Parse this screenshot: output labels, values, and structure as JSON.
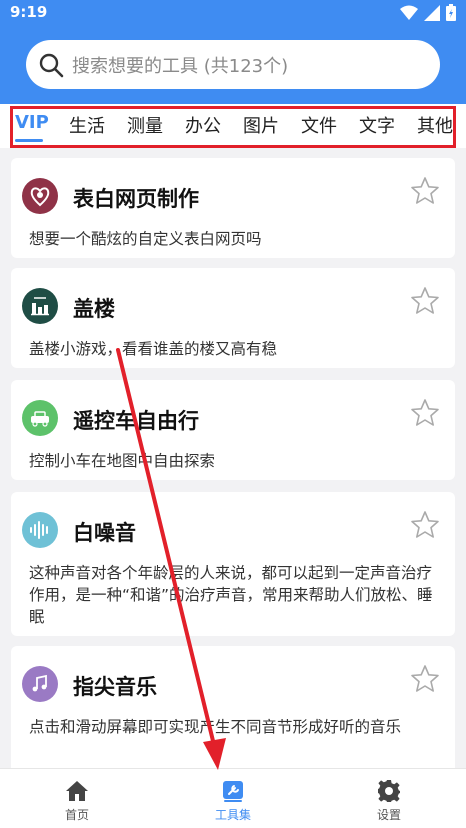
{
  "status_bar": {
    "time": "9:19"
  },
  "search": {
    "placeholder": "搜索想要的工具 (共123个)"
  },
  "tabs": [
    {
      "label": "VIP"
    },
    {
      "label": "生活"
    },
    {
      "label": "测量"
    },
    {
      "label": "办公"
    },
    {
      "label": "图片"
    },
    {
      "label": "文件"
    },
    {
      "label": "文字"
    },
    {
      "label": "其他"
    }
  ],
  "cards": [
    {
      "title": "表白网页制作",
      "desc": "想要一个酷炫的自定义表白网页吗",
      "icon": "heart-badge-icon",
      "color": "#8f3247"
    },
    {
      "title": "盖楼",
      "desc": "盖楼小游戏，看看谁盖的楼又高有稳",
      "icon": "building-icon",
      "color": "#1f4d45"
    },
    {
      "title": "遥控车自由行",
      "desc": "控制小车在地图中自由探索",
      "icon": "car-icon",
      "color": "#5dc26a"
    },
    {
      "title": "白噪音",
      "desc": "这种声音对各个年龄层的人来说，都可以起到一定声音治疗作用，是一种“和谐”的治疗声音，常用来帮助人们放松、睡眠",
      "icon": "soundwave-icon",
      "color": "#6fc1d6"
    },
    {
      "title": "指尖音乐",
      "desc": "点击和滑动屏幕即可实现产生不同音节形成好听的音乐",
      "icon": "music-icon",
      "color": "#9a7ac4"
    }
  ],
  "bottom_nav": [
    {
      "label": "首页",
      "icon": "home-icon"
    },
    {
      "label": "工具集",
      "icon": "toolbox-icon"
    },
    {
      "label": "设置",
      "icon": "gear-icon"
    }
  ],
  "colors": {
    "primary": "#3f8cf2",
    "highlight_frame": "#e2202a",
    "arrow": "#e2202a"
  }
}
